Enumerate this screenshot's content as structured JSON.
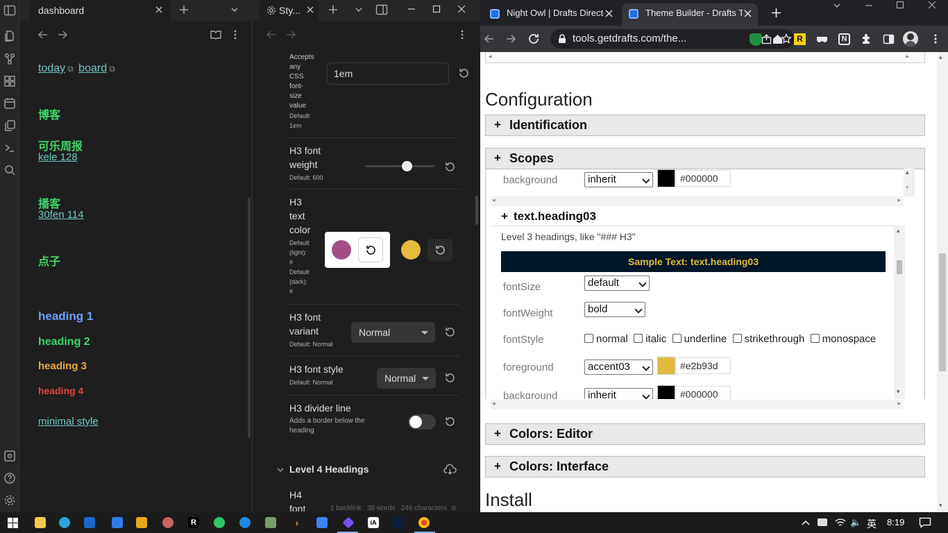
{
  "obsidian": {
    "left_tab": {
      "title": "dashboard"
    },
    "note": {
      "links": [
        "today",
        "board"
      ],
      "sections": [
        {
          "heading": "博客",
          "link": ""
        },
        {
          "heading": "可乐周报",
          "link": "kele 128"
        },
        {
          "heading": "播客",
          "link": "30fen 114"
        },
        {
          "heading": "点子",
          "link": ""
        }
      ],
      "headings": [
        "heading 1",
        "heading 2",
        "heading 3",
        "heading 4"
      ],
      "style_link": "minimal style"
    },
    "right_tab": {
      "title": "Sty..."
    },
    "settings": {
      "font_size": {
        "desc": [
          "Accepts",
          "any",
          "CSS",
          "font-",
          "size",
          "value"
        ],
        "default_label": "Default:",
        "default_value": "1em",
        "value": "1em"
      },
      "h3_weight": {
        "label": [
          "H3 font",
          "weight"
        ],
        "default": "Default: 600",
        "level": 0.6
      },
      "h3_color": {
        "label": [
          "H3",
          "text",
          "color"
        ],
        "default": [
          "Default",
          "(light):",
          "#",
          "Default",
          "(dark):",
          "#"
        ],
        "picker_color": "#a64d87",
        "dark_color": "#e5b93a"
      },
      "h3_variant": {
        "label": [
          "H3 font",
          "variant"
        ],
        "default": "Default: Normal",
        "value": "Normal"
      },
      "h3_style": {
        "label": "H3 font style",
        "default": "Default: Normal",
        "value": "Normal"
      },
      "h3_divider": {
        "label": "H3 divider line",
        "desc": [
          "Adds a border below the",
          "heading"
        ],
        "enabled": false
      },
      "level4": {
        "title": "Level 4 Headings"
      },
      "h4_font": {
        "label": [
          "H4",
          "font"
        ]
      }
    },
    "status": {
      "backlink": "1 backlink",
      "words": "38 words",
      "chars": "246 characters"
    }
  },
  "chrome": {
    "tabs": [
      {
        "title": "Night Owl | Drafts Directory",
        "active": false
      },
      {
        "title": "Theme Builder - Drafts Tools",
        "active": true
      }
    ],
    "url": "tools.getdrafts.com/the...",
    "page": {
      "configuration": "Configuration",
      "identification": "Identification",
      "scopes": "Scopes",
      "bg_row": {
        "label": "background",
        "select": "inherit",
        "hex": "#000000"
      },
      "heading03": {
        "title": "text.heading03",
        "desc": "Level 3 headings, like \"### H3\"",
        "sample": "Sample Text: text.heading03",
        "fontSize": {
          "label": "fontSize",
          "value": "default"
        },
        "fontWeight": {
          "label": "fontWeight",
          "value": "bold"
        },
        "fontStyle": {
          "label": "fontStyle",
          "options": [
            "normal",
            "italic",
            "underline",
            "strikethrough",
            "monospace"
          ]
        },
        "foreground": {
          "label": "foreground",
          "value": "accent03",
          "hex": "#e2b93d"
        },
        "background": {
          "label": "background",
          "value": "inherit",
          "hex": "#000000"
        }
      },
      "colors_editor": "Colors: Editor",
      "colors_interface": "Colors: Interface",
      "install": "Install"
    }
  },
  "taskbar": {
    "ime": "英",
    "time": "8:19"
  }
}
